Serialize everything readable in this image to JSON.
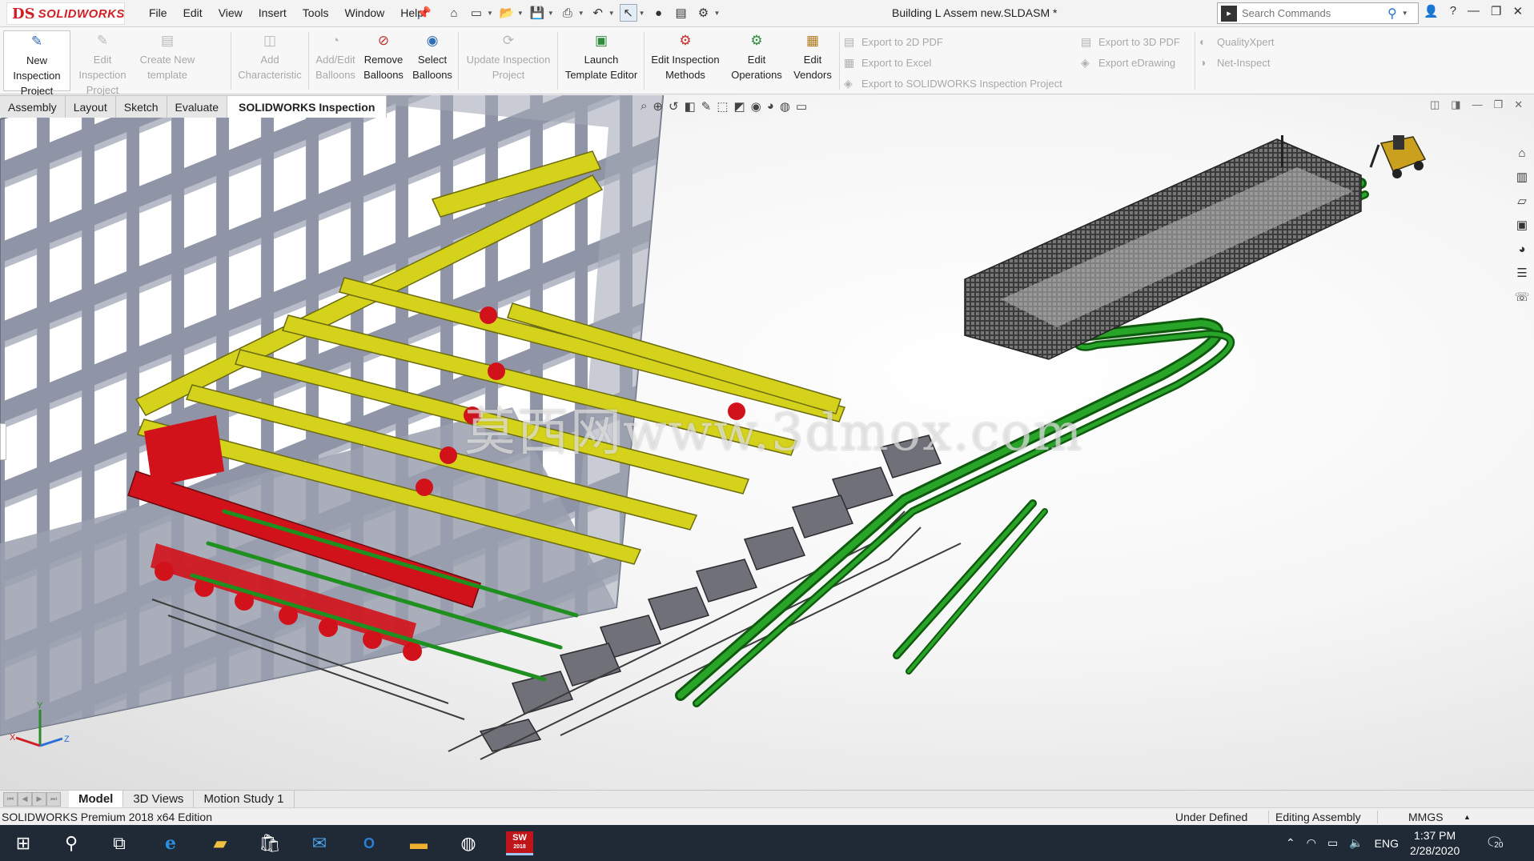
{
  "app": {
    "brand": "SOLIDWORKS",
    "brand_mark": "DS",
    "doc_title": "Building L Assem new.SLDASM *"
  },
  "menu": [
    "File",
    "Edit",
    "View",
    "Insert",
    "Tools",
    "Window",
    "Help"
  ],
  "search": {
    "placeholder": "Search Commands"
  },
  "ribbon": {
    "new_inspection_project": "New Inspection Project",
    "edit_inspection_project": "Edit Inspection Project",
    "create_new_template": "Create New template",
    "add_characteristic": "Add Characteristic",
    "add_edit_balloons": "Add/Edit Balloons",
    "remove_balloons": "Remove Balloons",
    "select_balloons": "Select Balloons",
    "update_inspection_project": "Update Inspection Project",
    "launch_template_editor": "Launch Template Editor",
    "edit_inspection_methods": "Edit Inspection Methods",
    "edit_operations": "Edit Operations",
    "edit_vendors": "Edit Vendors",
    "export_2d_pdf": "Export to 2D PDF",
    "export_excel": "Export to Excel",
    "export_sw_inspection_project": "Export to SOLIDWORKS Inspection Project",
    "export_3d_pdf": "Export to 3D PDF",
    "export_edrawing": "Export eDrawing",
    "qualityxpert": "QualityXpert",
    "net_inspect": "Net-Inspect"
  },
  "tabs": [
    "Assembly",
    "Layout",
    "Sketch",
    "Evaluate",
    "SOLIDWORKS Inspection"
  ],
  "active_tab": "SOLIDWORKS Inspection",
  "watermark": "莫西网www.3dmox.com",
  "triad": {
    "x": "X",
    "y": "Y",
    "z": "Z"
  },
  "bottom_tabs": [
    "Model",
    "3D Views",
    "Motion Study 1"
  ],
  "active_bottom_tab": "Model",
  "status": {
    "edition": "SOLIDWORKS Premium 2018 x64 Edition",
    "definition": "Under Defined",
    "mode": "Editing Assembly",
    "units": "MMGS"
  },
  "taskbar": {
    "sw_badge": "SW",
    "sw_year": "2018",
    "lang": "ENG",
    "time": "1:37 PM",
    "date": "2/28/2020",
    "notifications": "20"
  },
  "colors": {
    "brand_red": "#d01f25",
    "frame_grey": "#8f95a6",
    "hopper_yellow": "#d4d21b",
    "hopper_red": "#d2121a",
    "conveyor_green": "#1f8f1f",
    "taskbar": "#1f2a36"
  }
}
